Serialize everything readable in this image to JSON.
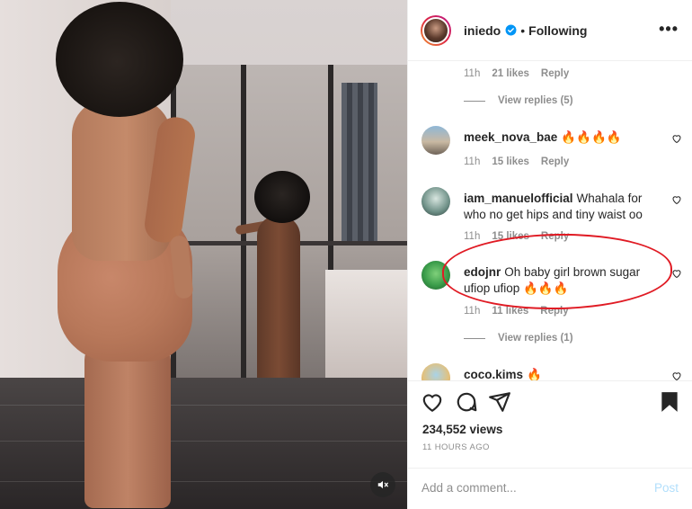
{
  "header": {
    "username": "iniedo",
    "separator": "•",
    "follow_status": "Following",
    "more_label": "•••"
  },
  "comments": {
    "top_meta": {
      "time": "11h",
      "likes": "21 likes",
      "reply": "Reply"
    },
    "view_replies_1": "View replies (5)",
    "items": [
      {
        "username": "meek_nova_bae",
        "text": "",
        "emoji": "🔥🔥🔥🔥",
        "time": "11h",
        "likes": "15 likes",
        "reply": "Reply"
      },
      {
        "username": "iam_manuelofficial",
        "text": "Whahala for who no get hips and tiny waist oo",
        "emoji": "",
        "time": "11h",
        "likes": "15 likes",
        "reply": "Reply"
      },
      {
        "username": "edojnr",
        "text": "Oh baby girl brown sugar ufiop ufiop",
        "emoji": "🔥🔥🔥",
        "time": "11h",
        "likes": "11 likes",
        "reply": "Reply"
      },
      {
        "username": "coco.kims",
        "text": "",
        "emoji": "🔥",
        "time": "",
        "likes": "",
        "reply": ""
      }
    ],
    "view_replies_2": "View replies (1)"
  },
  "actions": {
    "icons": [
      "heart-icon",
      "comment-icon",
      "share-icon",
      "save-icon"
    ],
    "views": "234,552 views",
    "time_ago": "11 HOURS AGO"
  },
  "add_comment": {
    "placeholder": "Add a comment...",
    "post_label": "Post"
  },
  "colors": {
    "verified_blue": "#0095f6",
    "annotation_red": "#e01b24",
    "post_disabled": "#b2dffc",
    "muted_text": "#8e8e8e"
  }
}
